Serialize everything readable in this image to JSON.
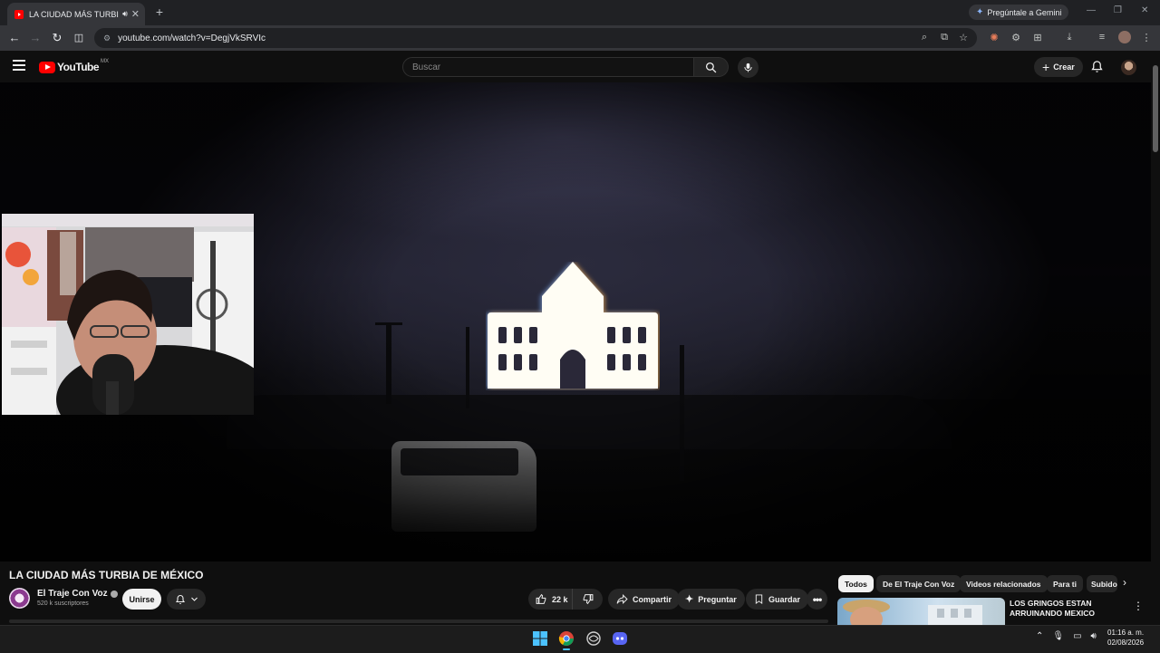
{
  "browser": {
    "tab_title": "LA CIUDAD MÁS TURBIA DE MÉXICO - YouTube",
    "url": "youtube.com/watch?v=DegjVkSRVIc",
    "gemini_label": "Pregúntale a Gemini",
    "new_tab_symbol": "+"
  },
  "youtube": {
    "logo_text": "YouTube",
    "country_code": "MX",
    "search_placeholder": "Buscar",
    "create_label": "Crear"
  },
  "video": {
    "title": "LA CIUDAD MÁS TURBIA DE MÉXICO",
    "channel": "El Traje Con Voz",
    "subscribers": "520 k suscriptores",
    "join_label": "Unirse",
    "likes": "22 k",
    "share_label": "Compartir",
    "ask_label": "Preguntar",
    "save_label": "Guardar"
  },
  "sidebar": {
    "chips": [
      "Todos",
      "De El Traje Con Voz",
      "Videos relacionados",
      "Para ti",
      "Subidos"
    ],
    "active_chip": "Todos",
    "recommendation_title": "LOS GRINGOS ESTAN ARRUINANDO MEXICO"
  },
  "taskbar": {
    "time": "01:16 a. m.",
    "date": "02/08/2026"
  },
  "colors": {
    "youtube_red": "#ff0000",
    "background": "#0f0f0f",
    "chrome_dark": "#202124"
  }
}
